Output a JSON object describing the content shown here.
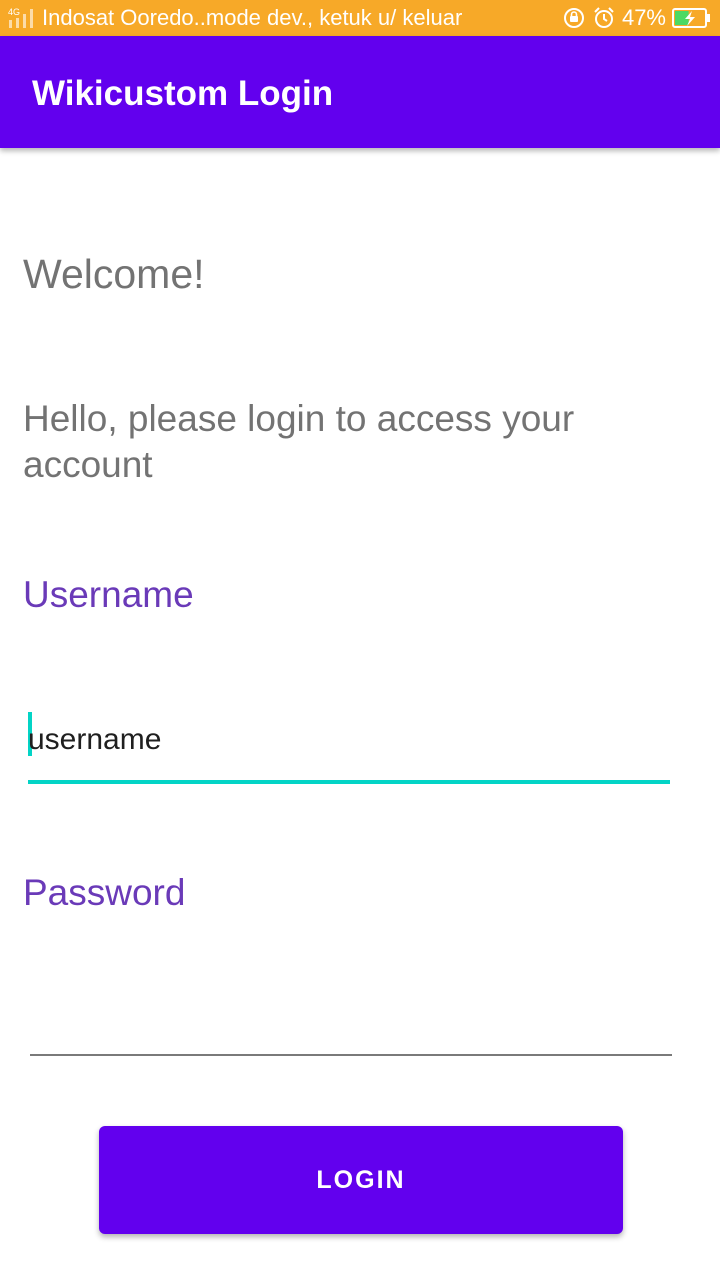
{
  "status_bar": {
    "network_type": "4G",
    "carrier_text": "Indosat Ooredo..mode dev., ketuk u/ keluar",
    "battery_percent": "47%",
    "battery_level": 0.47,
    "battery_color": "#4cd964",
    "background_color": "#f7a928",
    "icons": [
      "signal-icon",
      "rotation-lock-icon",
      "alarm-icon",
      "battery-charging-icon"
    ]
  },
  "app_bar": {
    "title": "Wikicustom Login",
    "background_color": "#6200ee"
  },
  "main": {
    "welcome": "Welcome!",
    "subtitle": "Hello, please login to access your account",
    "username": {
      "label": "Username",
      "value": "username",
      "focused": true,
      "accent_color": "#03d4c6"
    },
    "password": {
      "label": "Password",
      "value": ""
    },
    "label_color": "#6a3ab8",
    "login_button": {
      "label": "LOGIN",
      "color": "#6200ee"
    }
  }
}
